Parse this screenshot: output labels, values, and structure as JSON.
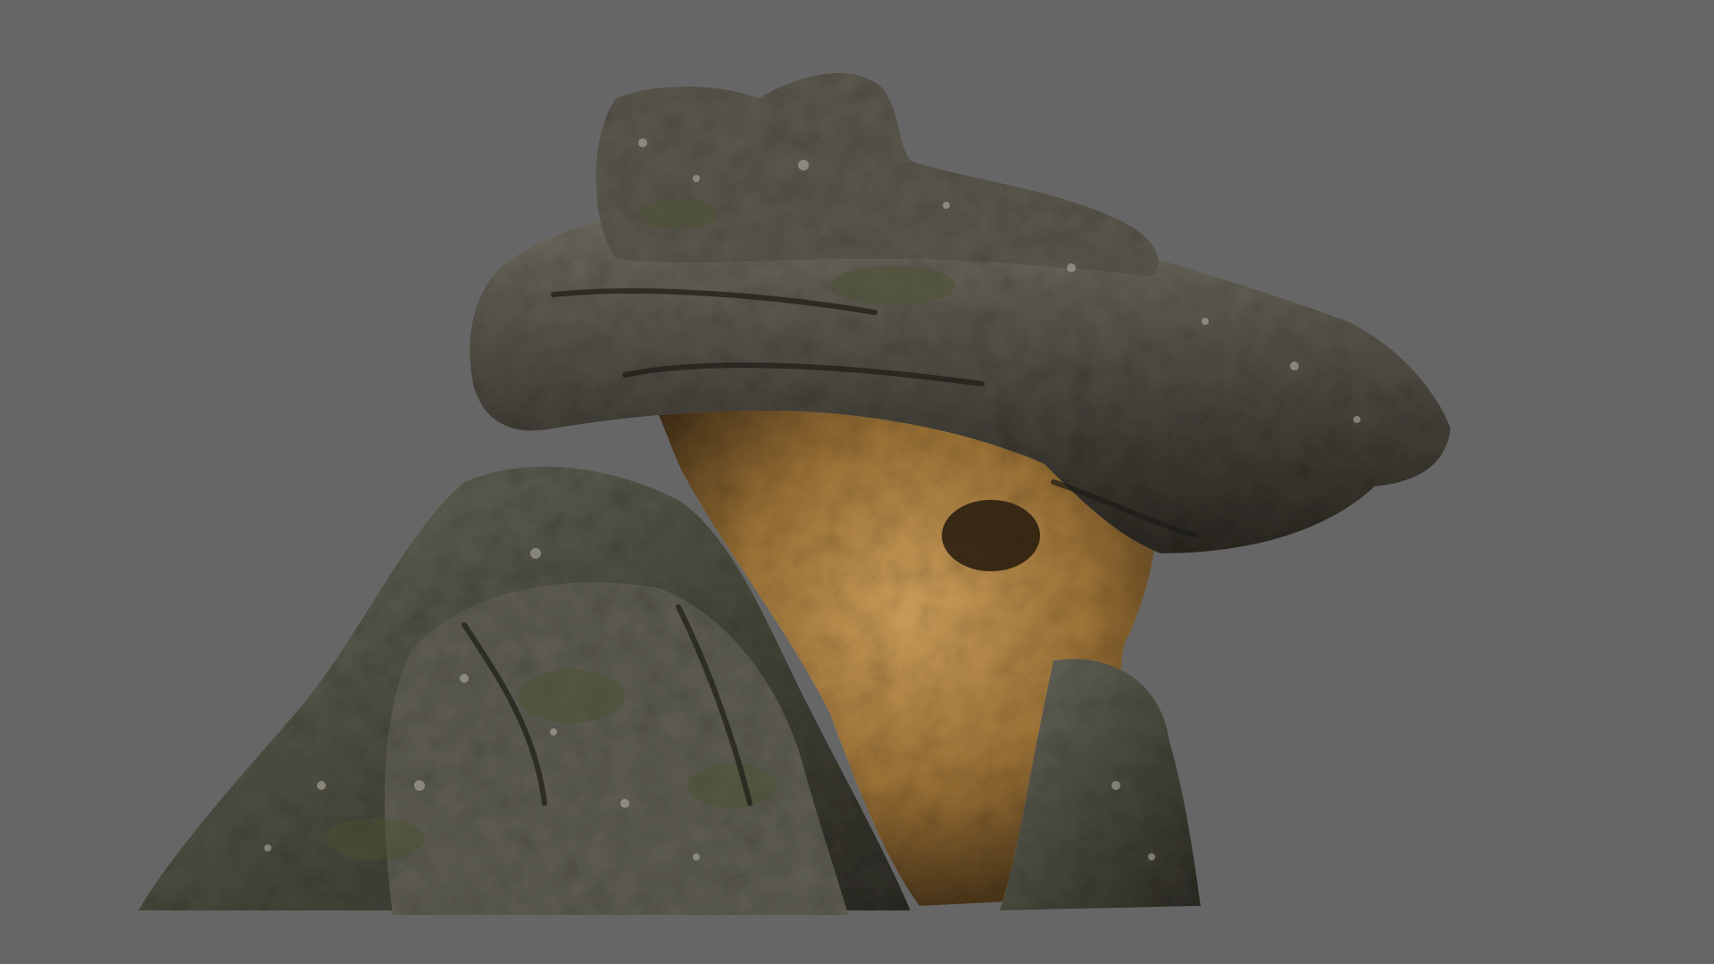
{
  "scene": {
    "background_color": "#666666",
    "subject": "rock-model",
    "colors": {
      "rock_dark": "#2e2b22",
      "rock_mid": "#57544a",
      "rock_light": "#8d8a80",
      "moss": "#4e5130",
      "lichen": "#b9b7ad",
      "cave_sand": "#a57a3c",
      "cave_glow": "#c99a55",
      "cave_shadow": "#3a2a16"
    }
  }
}
